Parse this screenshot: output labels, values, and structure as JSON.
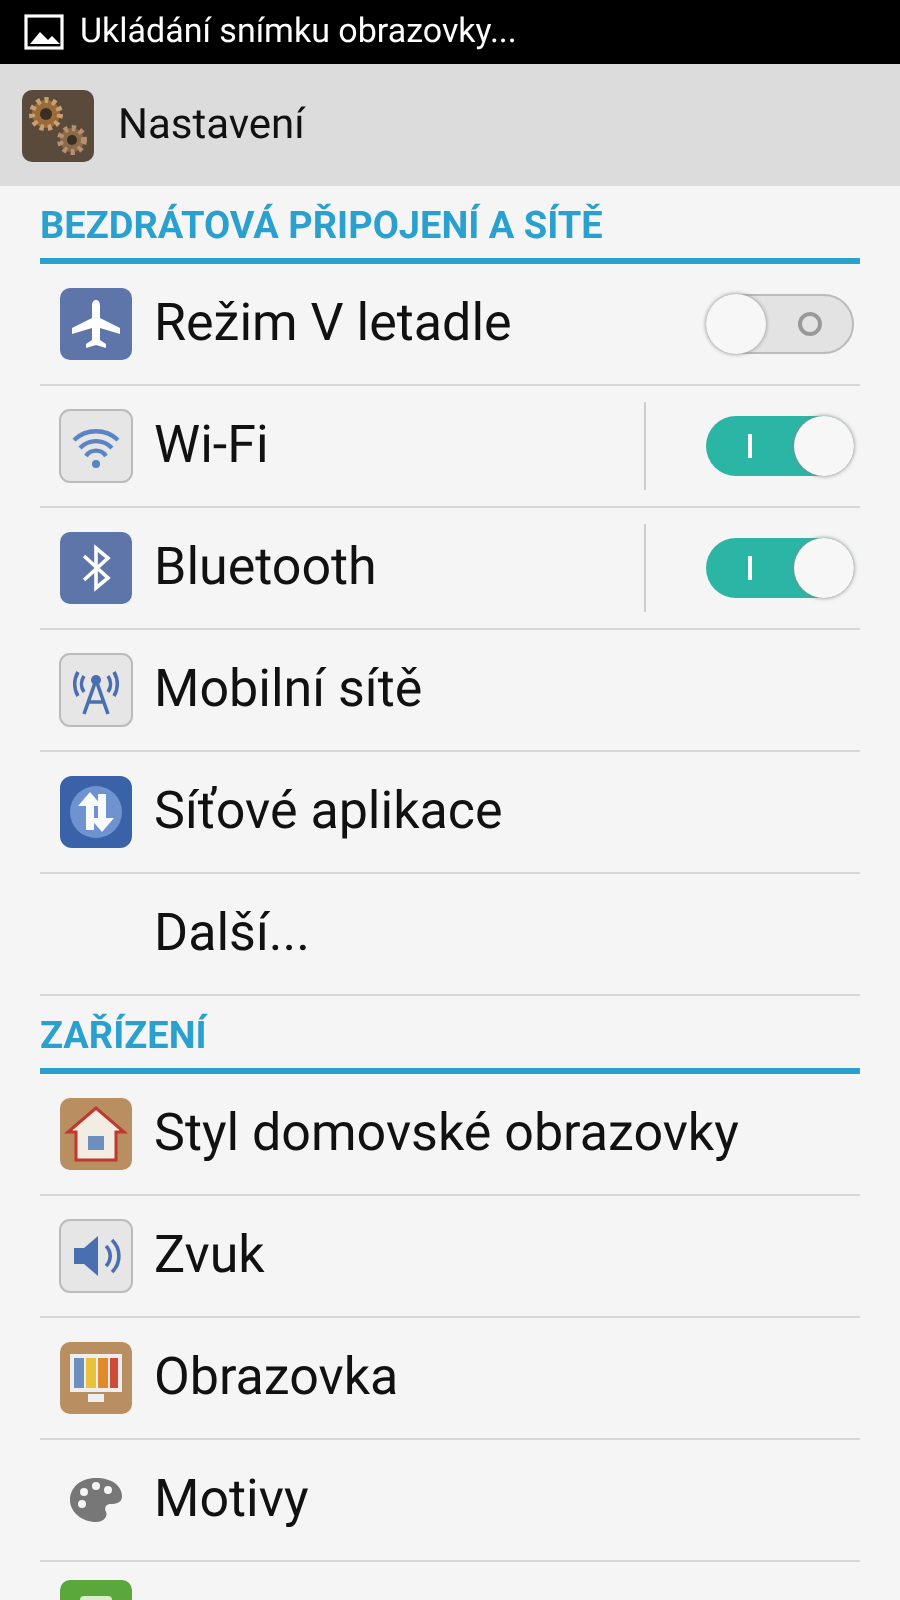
{
  "status_bar": {
    "notification": "Ukládání snímku obrazovky..."
  },
  "app_bar": {
    "title": "Nastavení"
  },
  "sections": [
    {
      "title": "BEZDRÁTOVÁ PŘIPOJENÍ A SÍTĚ",
      "items": [
        {
          "kind": "toggle",
          "label": "Režim V letadle",
          "on": false
        },
        {
          "kind": "split-toggle",
          "label": "Wi-Fi",
          "on": true
        },
        {
          "kind": "split-toggle",
          "label": "Bluetooth",
          "on": true
        },
        {
          "kind": "link",
          "label": "Mobilní sítě"
        },
        {
          "kind": "link",
          "label": "Síťové aplikace"
        },
        {
          "kind": "link",
          "label": "Další..."
        }
      ]
    },
    {
      "title": "ZAŘÍZENÍ",
      "items": [
        {
          "kind": "link",
          "label": "Styl domovské obrazovky"
        },
        {
          "kind": "link",
          "label": "Zvuk"
        },
        {
          "kind": "link",
          "label": "Obrazovka"
        },
        {
          "kind": "link",
          "label": "Motivy"
        },
        {
          "kind": "cut"
        }
      ]
    }
  ]
}
